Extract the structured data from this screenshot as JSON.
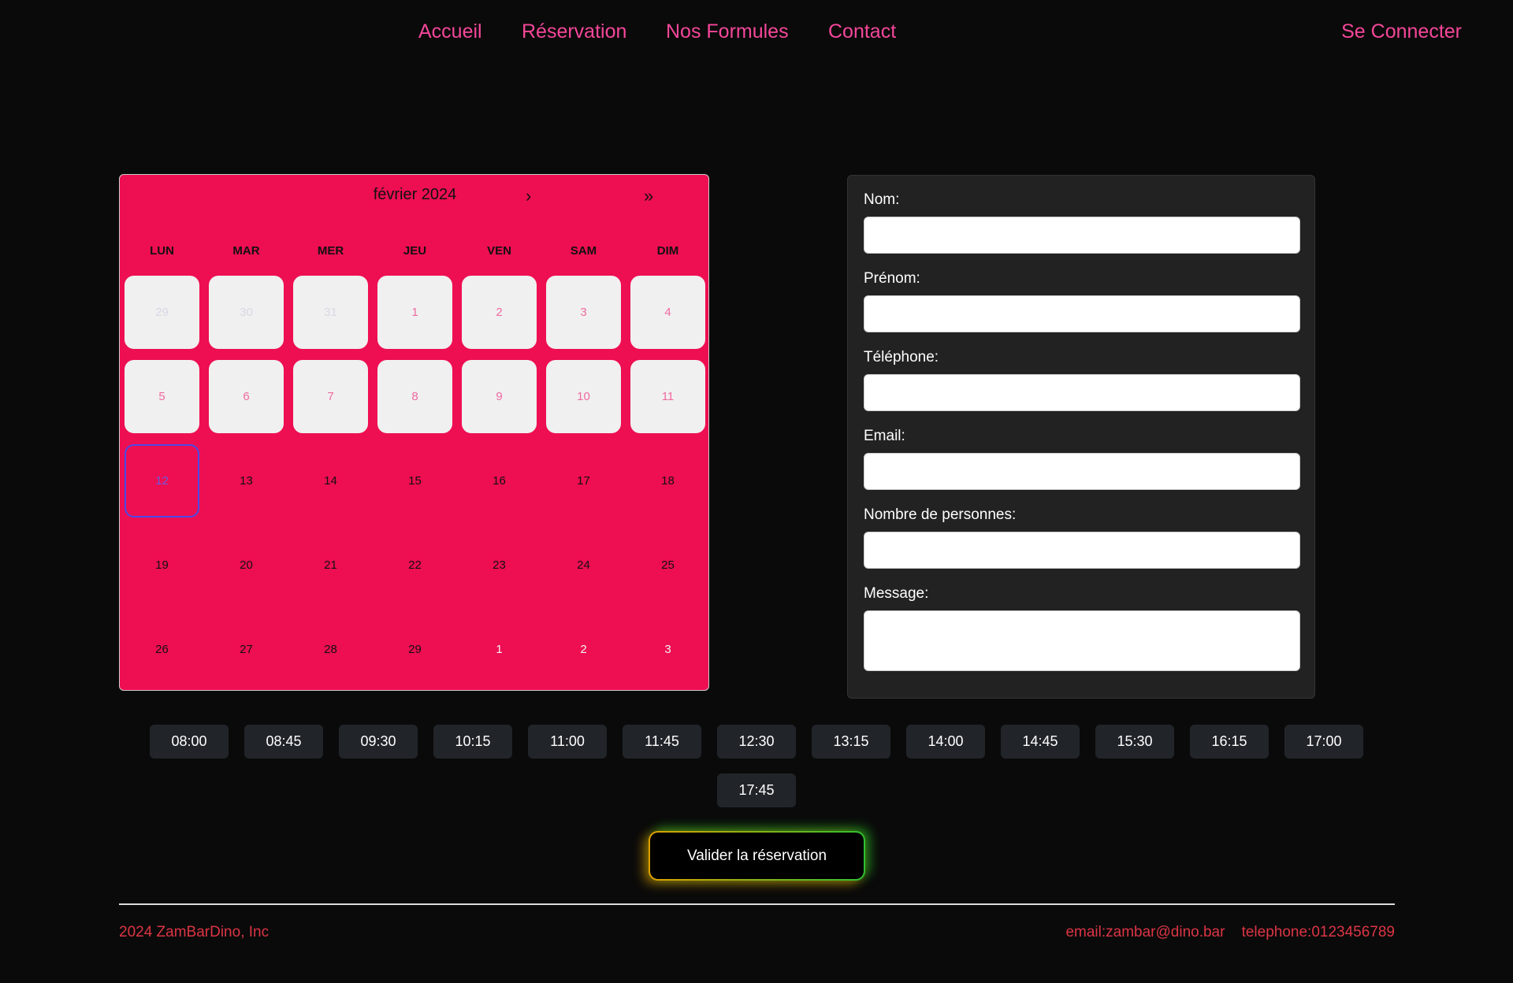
{
  "nav": {
    "items": [
      "Accueil",
      "Réservation",
      "Nos Formules",
      "Contact"
    ],
    "login": "Se Connecter"
  },
  "calendar": {
    "month_label": "février 2024",
    "next": "›",
    "next_year": "»",
    "weekdays": [
      "LUN",
      "MAR",
      "MER",
      "JEU",
      "VEN",
      "SAM",
      "DIM"
    ],
    "selected_day": "12",
    "weeks": [
      [
        "29",
        "30",
        "31",
        "1",
        "2",
        "3",
        "4"
      ],
      [
        "5",
        "6",
        "7",
        "8",
        "9",
        "10",
        "11"
      ],
      [
        "12",
        "13",
        "14",
        "15",
        "16",
        "17",
        "18"
      ],
      [
        "19",
        "20",
        "21",
        "22",
        "23",
        "24",
        "25"
      ],
      [
        "26",
        "27",
        "28",
        "29",
        "1",
        "2",
        "3"
      ]
    ]
  },
  "form": {
    "fields": [
      "Nom:",
      "Prénom:",
      "Téléphone:",
      "Email:",
      "Nombre de personnes:",
      "Message:"
    ]
  },
  "time_slots": [
    "08:00",
    "08:45",
    "09:30",
    "10:15",
    "11:00",
    "11:45",
    "12:30",
    "13:15",
    "14:00",
    "14:45",
    "15:30",
    "16:15",
    "17:00",
    "17:45"
  ],
  "submit_label": "Valider la réservation",
  "footer": {
    "copyright": "2024 ZamBarDino, Inc",
    "email": "email:zambar@dino.bar",
    "phone": "telephone:0123456789"
  },
  "colors": {
    "calendar_bg": "#ee0e52",
    "nav": "#f5479a",
    "footer": "#dc3545"
  }
}
